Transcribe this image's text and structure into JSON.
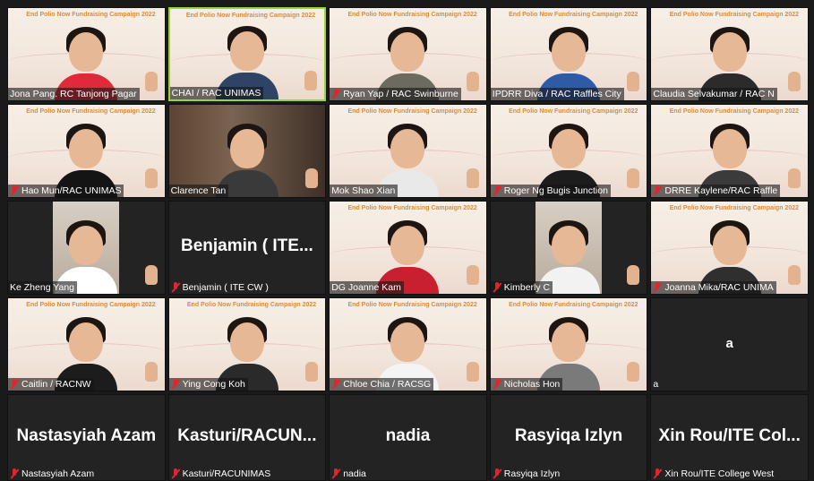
{
  "campaign_banner": "End Polio Now\nFundraising Campaign 2022",
  "tiles": [
    {
      "name": "Jona Pang. RC Tanjong Pagar",
      "muted": false,
      "style": "banner",
      "shirt": "#e02a3a"
    },
    {
      "name": "CHAI / RAC UNIMAS",
      "muted": false,
      "style": "banner",
      "shirt": "#2e4466",
      "active": true
    },
    {
      "name": "Ryan Yap / RAC Swinburne",
      "muted": true,
      "style": "banner",
      "shirt": "#6d6a60"
    },
    {
      "name": "IPDRR Diva / RAC Raffles City",
      "muted": false,
      "style": "banner",
      "shirt": "#2e5aa6"
    },
    {
      "name": "Claudia Selvakumar / RAC N",
      "muted": false,
      "style": "banner",
      "shirt": "#2b2b2b"
    },
    {
      "name": "Hao Mun/RAC UNIMAS",
      "muted": true,
      "style": "banner",
      "shirt": "#141414"
    },
    {
      "name": "Clarence Tan",
      "muted": false,
      "style": "room",
      "shirt": "#3a3a3a"
    },
    {
      "name": "Mok Shao Xian",
      "muted": false,
      "style": "banner",
      "shirt": "#e9e9e9"
    },
    {
      "name": "Roger Ng Bugis Junction",
      "muted": true,
      "style": "banner",
      "shirt": "#1d1d1d"
    },
    {
      "name": "DRRE Kaylene/RAC Raffle",
      "muted": true,
      "style": "banner",
      "shirt": "#3b3b3b"
    },
    {
      "name": "Ke Zheng Yang",
      "muted": false,
      "style": "phone",
      "shirt": "#ffffff"
    },
    {
      "name": "Benjamin ( ITE CW )",
      "muted": true,
      "style": "plain",
      "big": "Benjamin ( ITE..."
    },
    {
      "name": "DG Joanne Kam",
      "muted": false,
      "style": "banner",
      "shirt": "#c8202e"
    },
    {
      "name": "Kimberly C",
      "muted": true,
      "style": "phone",
      "shirt": "#f2f2f2"
    },
    {
      "name": "Joanna Mika/RAC UNIMA",
      "muted": true,
      "style": "banner",
      "shirt": "#2f2f2f"
    },
    {
      "name": "Caitlin / RACNW",
      "muted": true,
      "style": "banner",
      "shirt": "#1c1c1c"
    },
    {
      "name": "Ying Cong Koh",
      "muted": true,
      "style": "banner",
      "shirt": "#2a2a2a"
    },
    {
      "name": "Chloe Chia / RACSG",
      "muted": true,
      "style": "banner",
      "shirt": "#f4f4f4"
    },
    {
      "name": "Nicholas Hon",
      "muted": true,
      "style": "banner",
      "shirt": "#7a7a7a"
    },
    {
      "name": "a",
      "muted": false,
      "style": "plain",
      "big": "a",
      "small": true
    },
    {
      "name": "Nastasyiah Azam",
      "muted": true,
      "style": "plain",
      "big": "Nastasyiah Azam"
    },
    {
      "name": "Kasturi/RACUNIMAS",
      "muted": true,
      "style": "plain",
      "big": "Kasturi/RACUN..."
    },
    {
      "name": "nadia",
      "muted": true,
      "style": "plain",
      "big": "nadia"
    },
    {
      "name": "Rasyiqa Izlyn",
      "muted": true,
      "style": "plain",
      "big": "Rasyiqa Izlyn"
    },
    {
      "name": "Xin Rou/ITE College West",
      "muted": true,
      "style": "plain",
      "big": "Xin Rou/ITE Col..."
    }
  ],
  "icons": {
    "muted": "mic-muted-icon"
  },
  "colors": {
    "active_border": "#9bd43a",
    "muted_icon": "#e0262c",
    "banner_text": "#d98c3a"
  }
}
